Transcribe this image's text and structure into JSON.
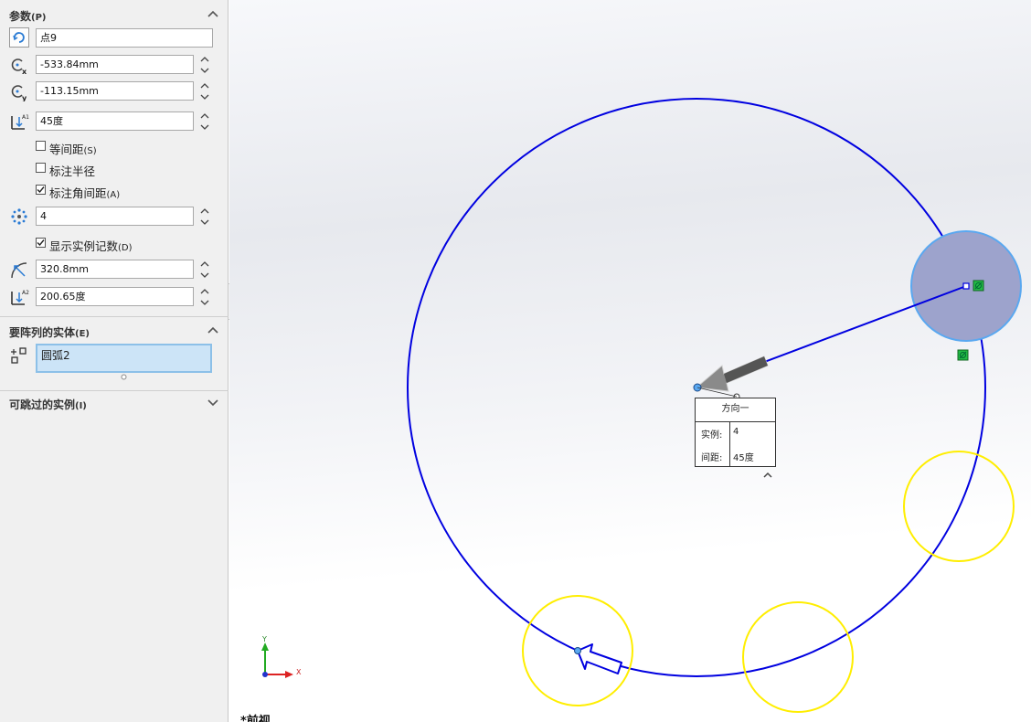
{
  "panel": {
    "params": {
      "title": "参数",
      "hotkey": "(P)",
      "center_point": "点9",
      "center_x": "-533.84mm",
      "center_y": "-113.15mm",
      "angle": "45度",
      "equal_spacing": {
        "label": "等间距",
        "hotkey": "(S)",
        "checked": false
      },
      "dim_radius": {
        "label": "标注半径",
        "checked": false
      },
      "dim_angle_spacing": {
        "label": "标注角间距",
        "hotkey": "(A)",
        "checked": true
      },
      "instance_count": "4",
      "show_instance_count": {
        "label": "显示实例记数",
        "hotkey": "(D)",
        "checked": true
      },
      "radius": "320.8mm",
      "arc_angle": "200.65度"
    },
    "entities": {
      "title": "要阵列的实体",
      "hotkey": "(E)",
      "items": [
        "圆弧2"
      ]
    },
    "skip": {
      "title": "可跳过的实例",
      "hotkey": "(I)"
    }
  },
  "callout": {
    "title": "方向一",
    "instances_label": "实例:",
    "instances_value": "4",
    "spacing_label": "间距:",
    "spacing_value": "45度"
  },
  "triad": {
    "x_label": "X",
    "y_label": "Y"
  },
  "view": {
    "label": "*前视"
  },
  "colors": {
    "sketch_blue": "#0000e0",
    "preview_yellow": "#ffee00",
    "selected_fill": "#9da3cc",
    "selected_edge": "#5aa8f0",
    "relation_green": "#22bb44"
  }
}
